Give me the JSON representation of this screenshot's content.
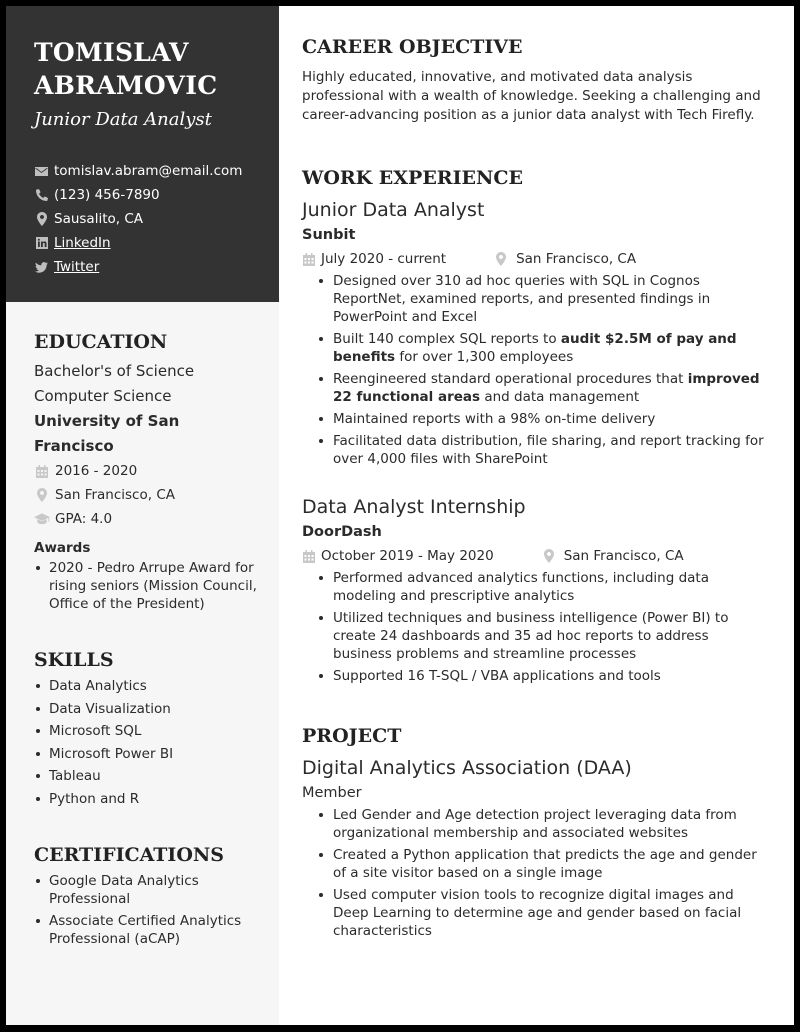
{
  "profile": {
    "name_line1": "TOMISLAV",
    "name_line2": "ABRAMOVIC",
    "title": "Junior Data Analyst"
  },
  "contacts": [
    {
      "icon": "envelope-icon",
      "text": "tomislav.abram@email.com",
      "link": false
    },
    {
      "icon": "phone-icon",
      "text": "(123) 456-7890",
      "link": false
    },
    {
      "icon": "map-pin-icon",
      "text": "Sausalito, CA",
      "link": false
    },
    {
      "icon": "linkedin-icon",
      "text": "LinkedIn",
      "link": true
    },
    {
      "icon": "twitter-icon",
      "text": "Twitter",
      "link": true
    }
  ],
  "education": {
    "heading": "EDUCATION",
    "degree": "Bachelor's of Science",
    "field": "Computer Science",
    "school": "University of San Francisco",
    "dates": "2016 - 2020",
    "location": "San Francisco, CA",
    "gpa": "GPA: 4.0",
    "awards_heading": "Awards",
    "awards": [
      "2020 - Pedro Arrupe Award for rising seniors (Mission Council, Office of the President)"
    ]
  },
  "skills": {
    "heading": "SKILLS",
    "items": [
      "Data Analytics",
      "Data Visualization",
      "Microsoft SQL",
      "Microsoft Power BI",
      "Tableau",
      "Python and R"
    ]
  },
  "certifications": {
    "heading": "CERTIFICATIONS",
    "items": [
      "Google Data Analytics Professional",
      "Associate Certified Analytics Professional (aCAP)"
    ]
  },
  "objective": {
    "heading": "CAREER OBJECTIVE",
    "text": "Highly educated, innovative, and motivated data analysis professional with a wealth of knowledge. Seeking a challenging and career-advancing position as a junior data analyst with Tech Firefly."
  },
  "experience": {
    "heading": "WORK EXPERIENCE",
    "jobs": [
      {
        "title": "Junior Data Analyst",
        "company": "Sunbit",
        "dates": "July 2020 - current",
        "location": "San Francisco, CA",
        "bullets": [
          [
            {
              "t": "Designed over 310 ad hoc queries with SQL in Cognos ReportNet, examined reports, and presented findings in PowerPoint and Excel"
            }
          ],
          [
            {
              "t": "Built 140 complex SQL reports to "
            },
            {
              "t": "audit $2.5M of pay and benefits",
              "b": true
            },
            {
              "t": " for over 1,300 employees"
            }
          ],
          [
            {
              "t": "Reengineered standard operational procedures that "
            },
            {
              "t": "improved 22 functional areas",
              "b": true
            },
            {
              "t": " and data management"
            }
          ],
          [
            {
              "t": "Maintained reports with a 98% on-time delivery"
            }
          ],
          [
            {
              "t": "Facilitated data distribution, file sharing, and report tracking for over 4,000 files with SharePoint"
            }
          ]
        ]
      },
      {
        "title": "Data Analyst Internship",
        "company": "DoorDash",
        "dates": "October 2019 - May 2020",
        "location": "San Francisco, CA",
        "bullets": [
          [
            {
              "t": "Performed advanced analytics functions, including data modeling and prescriptive analytics"
            }
          ],
          [
            {
              "t": "Utilized techniques and business intelligence (Power BI) to create 24 dashboards and 35 ad hoc reports to address business problems and streamline processes"
            }
          ],
          [
            {
              "t": "Supported 16 T-SQL / VBA applications and tools"
            }
          ]
        ]
      }
    ]
  },
  "project": {
    "heading": "PROJECT",
    "name": "Digital Analytics Association (DAA)",
    "role": "Member",
    "bullets": [
      "Led Gender and Age detection project leveraging data from organizational membership and associated websites",
      "Created a Python application that predicts the age and gender of a site visitor based on a single image",
      "Used computer vision tools to recognize digital images and Deep Learning to determine age and gender based on facial characteristics"
    ]
  },
  "colors": {
    "header_bg": "#333333",
    "sidebar_bg": "#f6f6f6",
    "frame": "#000000",
    "text": "#2b2b2b",
    "icon_gray": "#c8c8c8"
  }
}
